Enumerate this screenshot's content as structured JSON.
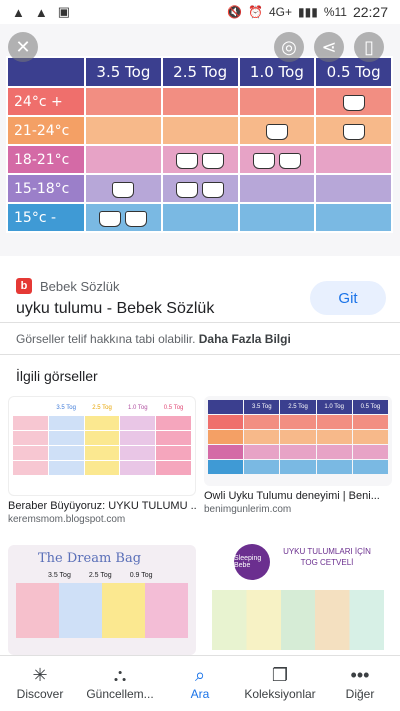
{
  "status_bar": {
    "left_icons": [
      "warning-icon",
      "warning-icon",
      "image-icon"
    ],
    "battery": "%11",
    "time": "22:27",
    "network": "4G+"
  },
  "hero": {
    "header": [
      "3.5 Tog",
      "2.5 Tog",
      "1.0 Tog",
      "0.5 Tog"
    ],
    "rows": [
      {
        "label": "24°c +",
        "cells": [
          0,
          0,
          0,
          1
        ]
      },
      {
        "label": "21-24°c",
        "cells": [
          0,
          0,
          1,
          1
        ]
      },
      {
        "label": "18-21°c",
        "cells": [
          0,
          2,
          2,
          0
        ]
      },
      {
        "label": "15-18°c",
        "cells": [
          1,
          2,
          0,
          0
        ]
      },
      {
        "label": "15°c -",
        "cells": [
          2,
          0,
          0,
          0
        ]
      }
    ]
  },
  "source": {
    "favicon": "b",
    "site": "Bebek Sözlük",
    "title": "uyku tulumu - Bebek Sözlük",
    "visit": "Git"
  },
  "copyright": {
    "text": "Görseller telif hakkına tabi olabilir.",
    "link": "Daha Fazla Bilgi"
  },
  "related": {
    "title": "İlgili görseller",
    "cards": [
      {
        "title": "Beraber Büyüyoruz: UYKU TULUMU ...",
        "source": "keremsmom.blogspot.com"
      },
      {
        "title": "Owli Uyku Tulumu deneyimi | Beni...",
        "source": "benimgunlerim.com"
      },
      {
        "title": "",
        "source": ""
      },
      {
        "title": "",
        "source": ""
      }
    ],
    "card1_headers": [
      "3.5 Tog",
      "2.5 Tog",
      "1.0 Tog",
      "0.5 Tog"
    ],
    "card2_headers": [
      "3.5 Tog",
      "2.5 Tog",
      "1.0 Tog",
      "0.5 Tog"
    ],
    "card3_brand": "The Dream Bag",
    "card3_headers": [
      "3.5 Tog",
      "2.5 Tog",
      "0.9 Tog"
    ],
    "card4_brand": "UYKU TULUMLARI İÇİN TOG CETVELİ",
    "card4_logo": "Sleeping Bebe"
  },
  "bottom_nav": [
    {
      "label": "Discover",
      "icon": "asterisk-icon",
      "active": false
    },
    {
      "label": "Güncellem...",
      "icon": "updates-icon",
      "active": false
    },
    {
      "label": "Ara",
      "icon": "search-icon",
      "active": true
    },
    {
      "label": "Koleksiyonlar",
      "icon": "collections-icon",
      "active": false
    },
    {
      "label": "Diğer",
      "icon": "more-icon",
      "active": false
    }
  ],
  "colors": {
    "accent": "#1a73e8",
    "header": "#3b3f8f"
  }
}
